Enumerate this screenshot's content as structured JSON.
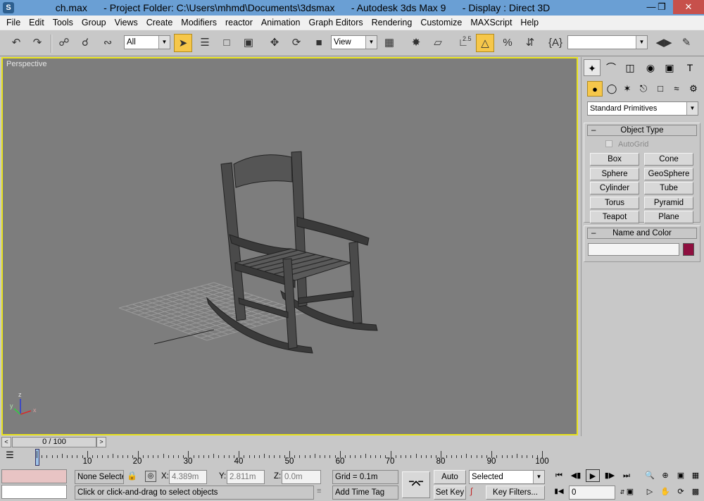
{
  "window": {
    "title": "ch.max      - Project Folder: C:\\Users\\mhmd\\Documents\\3dsmax      - Autodesk 3ds Max 9      - Display : Direct 3D",
    "icon": "3ds-max-logo-icon"
  },
  "menu": [
    "File",
    "Edit",
    "Tools",
    "Group",
    "Views",
    "Create",
    "Modifiers",
    "reactor",
    "Animation",
    "Graph Editors",
    "Rendering",
    "Customize",
    "MAXScript",
    "Help"
  ],
  "toolbar": {
    "selection_filter": "All",
    "reference_coord": "View",
    "snap_value": "2.5",
    "named_selection": ""
  },
  "viewport": {
    "label": "Perspective",
    "axis_labels": {
      "x": "x",
      "y": "y",
      "z": "z"
    },
    "border_color": "#e8e21c",
    "background_color": "#7d7d7d"
  },
  "command_panel": {
    "category": "Standard Primitives",
    "object_type": {
      "title": "Object Type",
      "autogrid": "AutoGrid",
      "buttons": [
        "Box",
        "Cone",
        "Sphere",
        "GeoSphere",
        "Cylinder",
        "Tube",
        "Torus",
        "Pyramid",
        "Teapot",
        "Plane"
      ]
    },
    "name_and_color": {
      "title": "Name and Color",
      "name": "",
      "color": "#8e0f3f"
    }
  },
  "timeline": {
    "frame_display": "0 / 100",
    "ticks": [
      "0",
      "10",
      "20",
      "30",
      "40",
      "50",
      "60",
      "70",
      "80",
      "90",
      "100"
    ],
    "current_frame": 0,
    "total_frames": 100
  },
  "status": {
    "selection": "None Selecte",
    "x_label": "X:",
    "x_value": "4.389m",
    "y_label": "Y:",
    "y_value": "2.811m",
    "z_label": "Z:",
    "z_value": "0.0m",
    "grid": "Grid = 0.1m",
    "prompt": "Click or click-and-drag to select objects",
    "add_time_tag": "Add Time Tag",
    "auto_key": "Auto Key",
    "set_key": "Set Key",
    "key_mode": "Selected",
    "key_filters": "Key Filters...",
    "frame_field": "0"
  }
}
